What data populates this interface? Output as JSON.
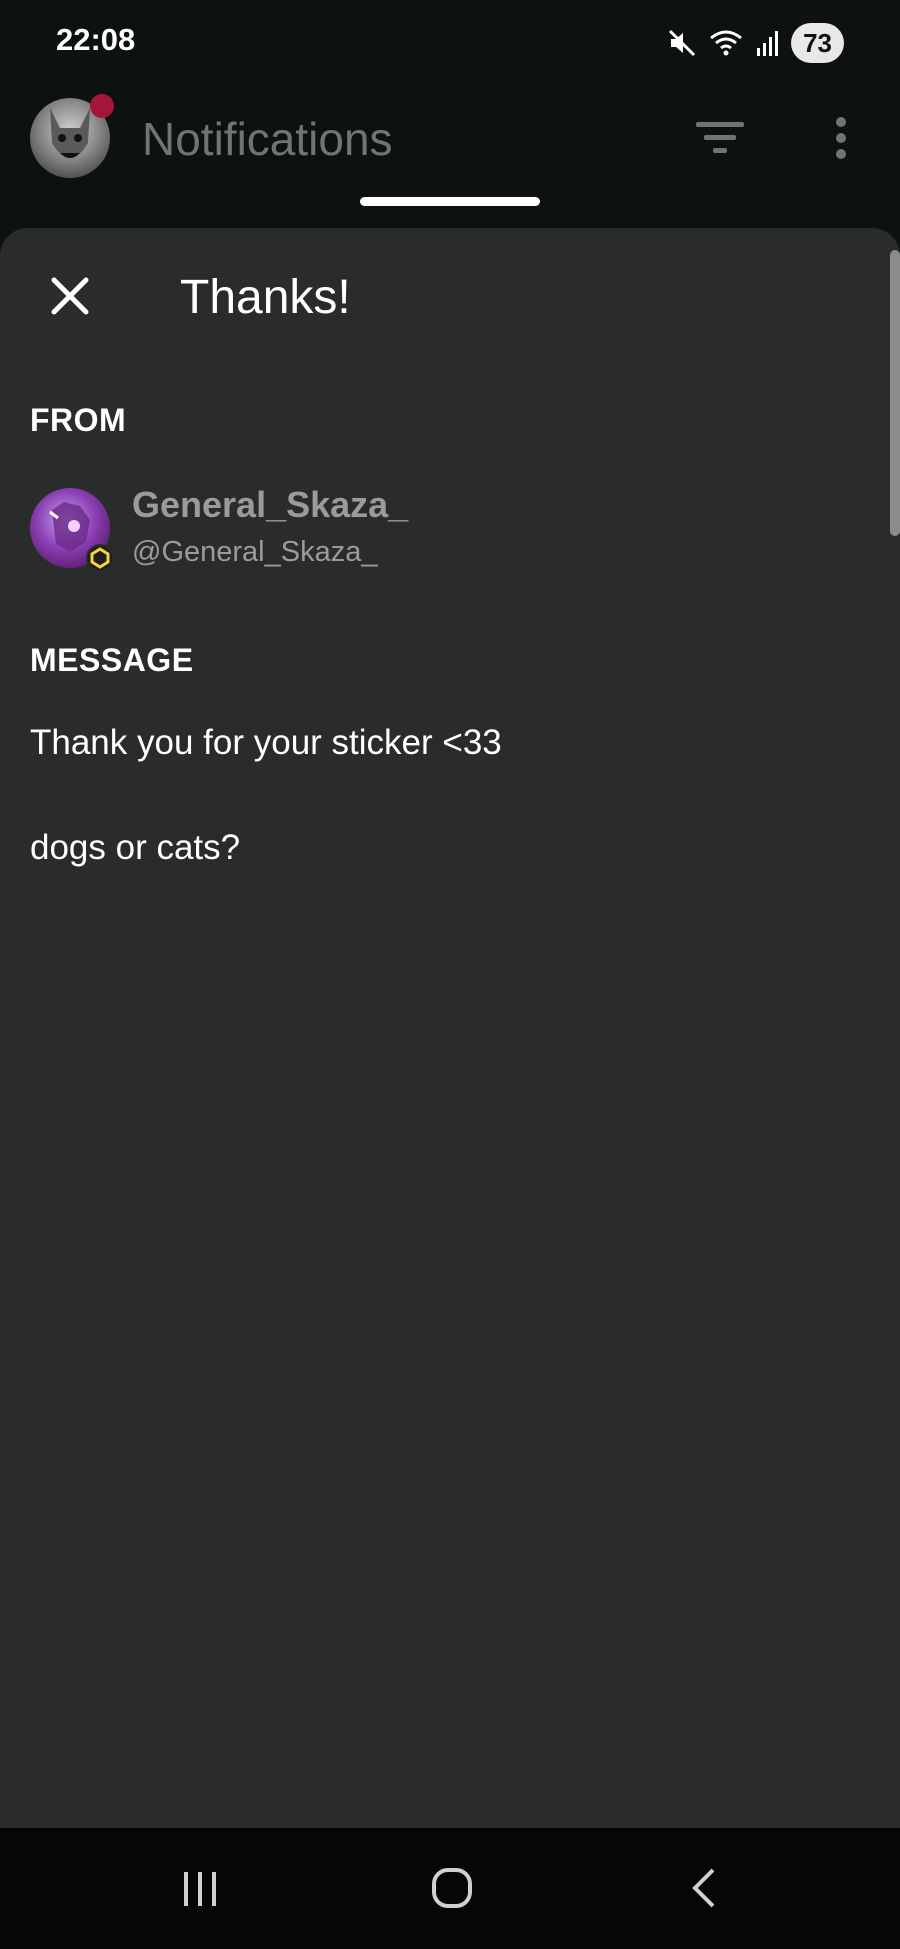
{
  "status_bar": {
    "time": "22:08",
    "battery": "73",
    "icons": [
      "mute-icon",
      "wifi-icon",
      "signal-icon"
    ]
  },
  "header": {
    "title": "Notifications",
    "avatar_icon": "user-avatar",
    "notification_dot_color": "#a3163a",
    "filter_icon": "filter-icon",
    "more_icon": "more-vertical-icon"
  },
  "sheet": {
    "title": "Thanks!",
    "close_icon": "close-icon",
    "from_label": "FROM",
    "sender": {
      "display_name": "General_Skaza_",
      "handle": "@General_Skaza_"
    },
    "message_label": "MESSAGE",
    "message_lines": [
      "Thank you for your sticker <33",
      "dogs or cats?"
    ]
  },
  "nav_bar": {
    "recents_icon": "recents-icon",
    "home_icon": "home-icon",
    "back_icon": "back-icon"
  },
  "colors": {
    "background": "#0d1111",
    "sheet": "#2a2c2b",
    "muted_text": "#9a9c9c",
    "accent_dot": "#a3163a"
  }
}
